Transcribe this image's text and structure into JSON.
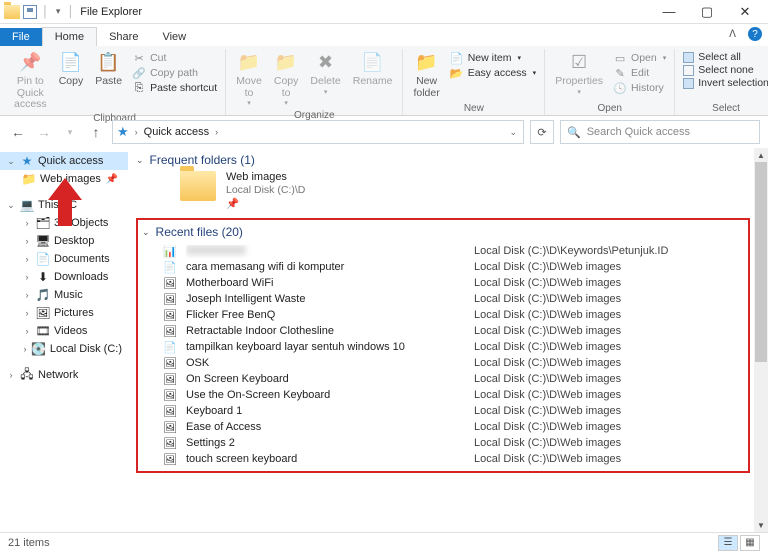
{
  "titlebar": {
    "title": "File Explorer"
  },
  "win": {
    "min": "—",
    "max": "▢",
    "close": "✕"
  },
  "tabs": {
    "file": "File",
    "home": "Home",
    "share": "Share",
    "view": "View"
  },
  "ribbon": {
    "clipboard": {
      "pin": "Pin to Quick\naccess",
      "copy": "Copy",
      "paste": "Paste",
      "cut": "Cut",
      "copypath": "Copy path",
      "pasteshortcut": "Paste shortcut",
      "label": "Clipboard"
    },
    "organize": {
      "moveto": "Move\nto",
      "copyto": "Copy\nto",
      "delete": "Delete",
      "rename": "Rename",
      "label": "Organize"
    },
    "new": {
      "newfolder": "New\nfolder",
      "newitem": "New item",
      "easyaccess": "Easy access",
      "label": "New"
    },
    "open": {
      "properties": "Properties",
      "open": "Open",
      "edit": "Edit",
      "history": "History",
      "label": "Open"
    },
    "select": {
      "selectall": "Select all",
      "selectnone": "Select none",
      "invert": "Invert selection",
      "label": "Select"
    }
  },
  "address": {
    "crumb": "Quick access"
  },
  "search": {
    "placeholder": "Search Quick access"
  },
  "sidebar": {
    "quick": "Quick access",
    "webimages": "Web images",
    "thispc": "This PC",
    "items": [
      {
        "label": "3D Objects"
      },
      {
        "label": "Desktop"
      },
      {
        "label": "Documents"
      },
      {
        "label": "Downloads"
      },
      {
        "label": "Music"
      },
      {
        "label": "Pictures"
      },
      {
        "label": "Videos"
      },
      {
        "label": "Local Disk (C:)"
      }
    ],
    "network": "Network"
  },
  "content": {
    "group_frequent": "Frequent folders (1)",
    "folder": {
      "name": "Web images",
      "sub": "Local Disk (C:)\\D"
    },
    "group_recent": "Recent files (20)",
    "files": [
      {
        "name": "",
        "loc": "Local Disk (C:)\\D\\Keywords\\Petunjuk.ID",
        "blurred": true,
        "icon": "excel"
      },
      {
        "name": "cara memasang wifi di komputer",
        "loc": "Local Disk (C:)\\D\\Web images",
        "icon": "doc"
      },
      {
        "name": "Motherboard WiFi",
        "loc": "Local Disk (C:)\\D\\Web images",
        "icon": "img"
      },
      {
        "name": "Joseph Intelligent Waste",
        "loc": "Local Disk (C:)\\D\\Web images",
        "icon": "img"
      },
      {
        "name": "Flicker Free BenQ",
        "loc": "Local Disk (C:)\\D\\Web images",
        "icon": "img"
      },
      {
        "name": "Retractable Indoor Clothesline",
        "loc": "Local Disk (C:)\\D\\Web images",
        "icon": "img"
      },
      {
        "name": "tampilkan keyboard layar sentuh windows 10",
        "loc": "Local Disk (C:)\\D\\Web images",
        "icon": "doc"
      },
      {
        "name": "OSK",
        "loc": "Local Disk (C:)\\D\\Web images",
        "icon": "img"
      },
      {
        "name": "On Screen Keyboard",
        "loc": "Local Disk (C:)\\D\\Web images",
        "icon": "img"
      },
      {
        "name": "Use the On-Screen Keyboard",
        "loc": "Local Disk (C:)\\D\\Web images",
        "icon": "img"
      },
      {
        "name": "Keyboard 1",
        "loc": "Local Disk (C:)\\D\\Web images",
        "icon": "img"
      },
      {
        "name": "Ease of Access",
        "loc": "Local Disk (C:)\\D\\Web images",
        "icon": "img"
      },
      {
        "name": "Settings 2",
        "loc": "Local Disk (C:)\\D\\Web images",
        "icon": "img"
      },
      {
        "name": "touch screen keyboard",
        "loc": "Local Disk (C:)\\D\\Web images",
        "icon": "img"
      }
    ]
  },
  "status": {
    "count": "21 items"
  }
}
